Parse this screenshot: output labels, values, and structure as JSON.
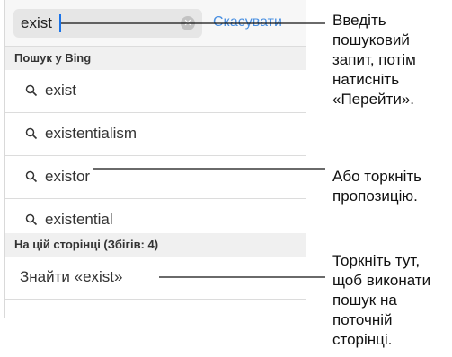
{
  "search": {
    "query": "exist",
    "cancel_label": "Скасувати"
  },
  "sections": {
    "bing_header": "Пошук у Bing",
    "page_header": "На цій сторінці (Збігів: 4)"
  },
  "suggestions": [
    "exist",
    "existentialism",
    "existor",
    "existential"
  ],
  "find_on_page": "Знайти «exist»",
  "callouts": {
    "search": "Введіть\nпошуковий\nзапит, потім\nнатисніть\n«Перейти».",
    "suggestion": "Або торкніть\nпропозицію.",
    "find": "Торкніть тут,\nщоб виконати\nпошук на\nпоточній\nсторінці."
  }
}
